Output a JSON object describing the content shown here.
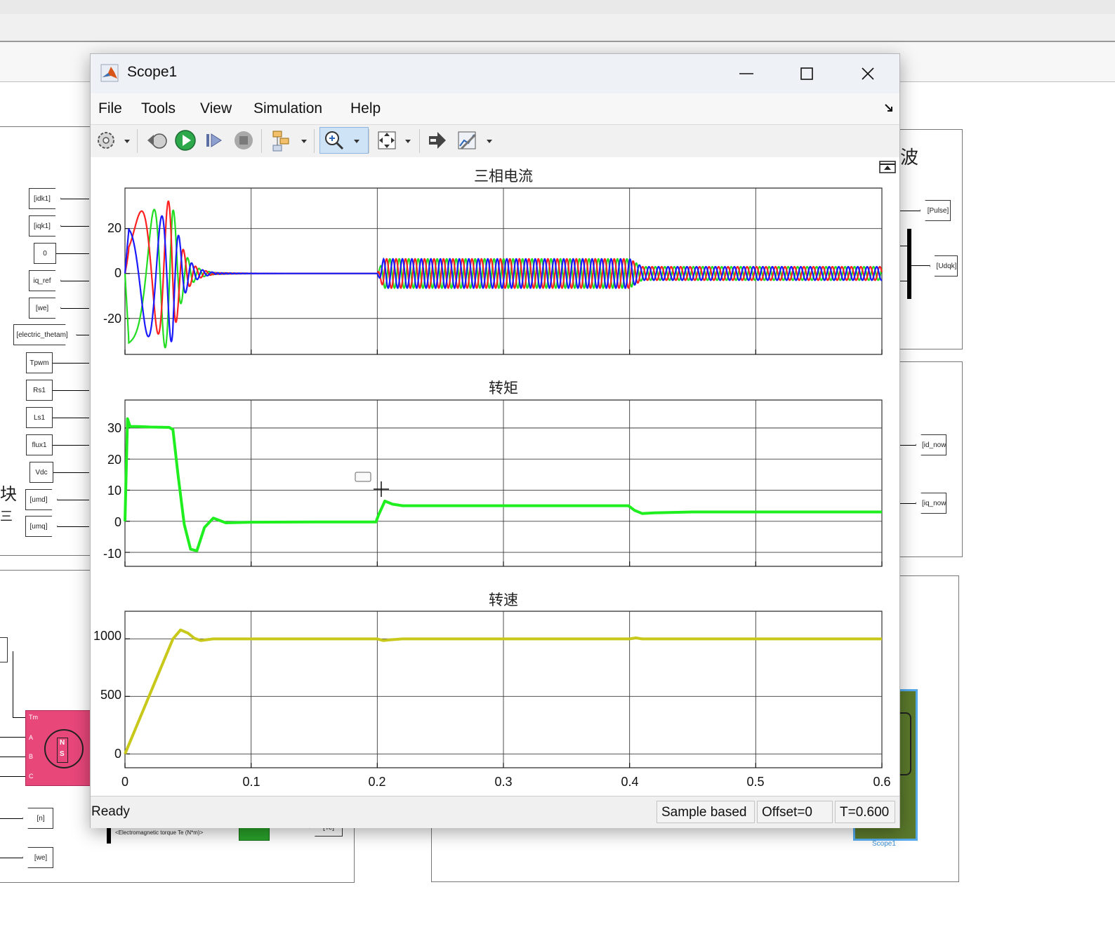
{
  "window": {
    "title": "Scope1"
  },
  "menu": {
    "items": [
      "File",
      "Tools",
      "View",
      "Simulation",
      "Help"
    ]
  },
  "toolbar": {
    "icons": [
      "settings-icon",
      "step-back-icon",
      "run-icon",
      "step-forward-icon",
      "stop-icon",
      "highlight-block-icon",
      "zoom-in-icon",
      "autoscale-icon",
      "restore-layout-icon",
      "measurements-icon"
    ]
  },
  "plots": [
    {
      "title": "三相电流",
      "yticks": [
        "20",
        "0",
        "-20"
      ]
    },
    {
      "title": "转矩",
      "yticks": [
        "30",
        "20",
        "10",
        "0",
        "-10"
      ]
    },
    {
      "title": "转速",
      "yticks": [
        "1000",
        "500",
        "0"
      ]
    }
  ],
  "xticks": [
    "0",
    "0.1",
    "0.2",
    "0.3",
    "0.4",
    "0.5",
    "0.6"
  ],
  "chart_data": [
    {
      "type": "line",
      "title": "三相电流",
      "xlim": [
        0,
        0.6
      ],
      "ylim": [
        -36,
        38
      ],
      "grid": true,
      "series": [
        {
          "color": "#1a1aff",
          "description": "phase A current: large startup oscillation (~30 amplitude) decaying to 0 by t≈0.07, ~0 until t=0.2, sinusoid amplitude ≈6 for 0.2–0.4, amplitude ≈3 for 0.4–0.6"
        },
        {
          "color": "#ff2020",
          "description": "phase B current (120° shifted)"
        },
        {
          "color": "#22dd22",
          "description": "phase C current (240° shifted)"
        }
      ]
    },
    {
      "type": "line",
      "title": "转矩",
      "xlim": [
        0,
        0.6
      ],
      "ylim": [
        -14.5,
        39
      ],
      "grid": true,
      "series": [
        {
          "color": "#1fef1f",
          "x": [
            0,
            0.002,
            0.004,
            0.01,
            0.02,
            0.035,
            0.038,
            0.042,
            0.047,
            0.052,
            0.057,
            0.063,
            0.07,
            0.08,
            0.1,
            0.15,
            0.199,
            0.201,
            0.206,
            0.212,
            0.22,
            0.25,
            0.3,
            0.35,
            0.399,
            0.404,
            0.41,
            0.42,
            0.45,
            0.5,
            0.6
          ],
          "y": [
            0,
            33,
            30.5,
            30.5,
            30.3,
            30.2,
            29.5,
            15,
            -1,
            -9,
            -9.5,
            -2,
            1,
            -0.5,
            -0.3,
            -0.2,
            -0.2,
            2,
            6.5,
            5.5,
            5,
            5,
            5,
            5,
            5,
            3.5,
            2.5,
            2.7,
            3,
            3,
            3
          ]
        }
      ]
    },
    {
      "type": "line",
      "title": "转速",
      "xlim": [
        0,
        0.6
      ],
      "ylim": [
        -120,
        1240
      ],
      "grid": true,
      "series": [
        {
          "color": "#c8c81a",
          "x": [
            0,
            0.038,
            0.044,
            0.05,
            0.055,
            0.06,
            0.065,
            0.07,
            0.09,
            0.1,
            0.15,
            0.2,
            0.205,
            0.21,
            0.22,
            0.25,
            0.3,
            0.35,
            0.4,
            0.405,
            0.41,
            0.45,
            0.5,
            0.6
          ],
          "y": [
            0,
            1000,
            1078,
            1050,
            1005,
            985,
            993,
            1000,
            1000,
            1000,
            1000,
            1000,
            985,
            992,
            1000,
            1000,
            1000,
            1000,
            1000,
            1008,
            1000,
            1000,
            1000,
            1000
          ]
        }
      ]
    }
  ],
  "status": {
    "ready": "Ready",
    "sample_mode": "Sample based",
    "offset": "Offset=0",
    "time": "T=0.600"
  },
  "background": {
    "left_tags": [
      "[idk1]",
      "[iqk1]",
      "0",
      "iq_ref",
      "[we]",
      "[electric_thetam]",
      "Tpwm",
      "Rs1",
      "Ls1",
      "flux1",
      "Vdc",
      "[umd]",
      "[umq]"
    ],
    "right_tags": [
      "[Pulse]",
      "[Udqk]",
      "[id_now]",
      "[iq_now]"
    ],
    "bottom_tags": [
      "[n]",
      "[we]",
      "[Te]"
    ],
    "motor_ports": [
      "Tm",
      "A",
      "B",
      "C"
    ],
    "motor_symbol": [
      "N",
      "S"
    ],
    "te_label": "<Electromagnetic torque Te (N*m)>",
    "scope_block_label": "Scope1",
    "side_chars": [
      "波",
      "块",
      "三"
    ]
  }
}
